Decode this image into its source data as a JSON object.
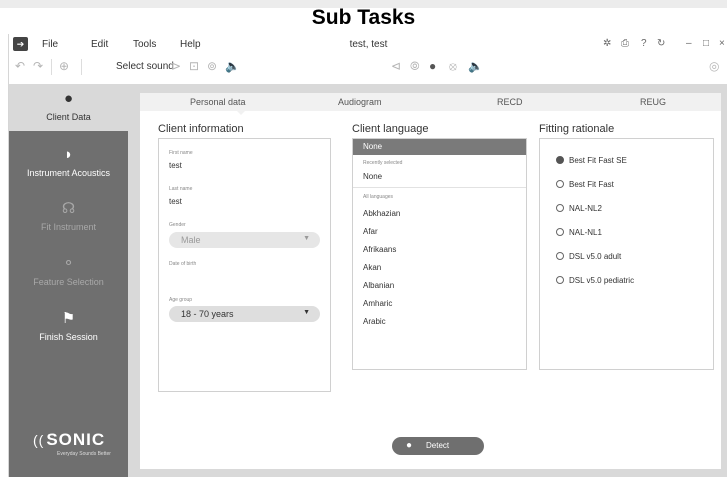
{
  "page_caption": "Sub Tasks",
  "menu": {
    "items": [
      "File",
      "Edit",
      "Tools",
      "Help"
    ],
    "window_title": "test, test",
    "system_icons": [
      "gear-icon",
      "print-icon",
      "help-icon",
      "refresh-icon",
      "minimize-icon",
      "maximize-icon",
      "close-icon"
    ]
  },
  "toolbar": {
    "select_sound_label": "Select sound",
    "icons_left": [
      "undo-icon",
      "redo-icon",
      "target-icon"
    ],
    "icons_sound": [
      "play-icon",
      "stop-icon",
      "record-icon",
      "speaker-icon"
    ],
    "icons_center": [
      "left-arrow-icon",
      "ear-icon",
      "cat-icon",
      "ear-muted-icon",
      "speaker-icon"
    ],
    "icons_right": [
      "wireless-icon"
    ]
  },
  "sidebar": {
    "items": [
      {
        "label": "Client Data",
        "icon": "user-icon",
        "state": "active"
      },
      {
        "label": "Instrument Acoustics",
        "icon": "hearing-aid-icon",
        "state": "enabled"
      },
      {
        "label": "Fit Instrument",
        "icon": "fit-icon",
        "state": "disabled"
      },
      {
        "label": "Feature Selection",
        "icon": "feature-icon",
        "state": "disabled"
      },
      {
        "label": "Finish Session",
        "icon": "flag-icon",
        "state": "enabled"
      }
    ],
    "brand": {
      "name": "SONIC",
      "tagline": "Everyday Sounds Better"
    }
  },
  "tabs": [
    "Personal data",
    "Audiogram",
    "RECD",
    "REUG"
  ],
  "client_info": {
    "title": "Client information",
    "first_name_label": "First name",
    "first_name_value": "test",
    "last_name_label": "Last name",
    "last_name_value": "test",
    "gender_label": "Gender",
    "gender_value": "Male",
    "dob_label": "Date of birth",
    "dob_value": "",
    "age_group_label": "Age group",
    "age_group_value": "18 - 70 years"
  },
  "client_language": {
    "title": "Client language",
    "selected": "None",
    "recent_label": "Recently selected",
    "recent_items": [
      "None"
    ],
    "all_label": "All languages",
    "all_items": [
      "Abkhazian",
      "Afar",
      "Afrikaans",
      "Akan",
      "Albanian",
      "Amharic",
      "Arabic"
    ]
  },
  "fitting_rationale": {
    "title": "Fitting rationale",
    "options": [
      "Best Fit Fast SE",
      "Best Fit Fast",
      "NAL-NL2",
      "NAL-NL1",
      "DSL v5.0 adult",
      "DSL v5.0 pediatric"
    ],
    "selected_index": 0
  },
  "detect_button": {
    "label": "Detect",
    "icon": "cat-icon"
  }
}
